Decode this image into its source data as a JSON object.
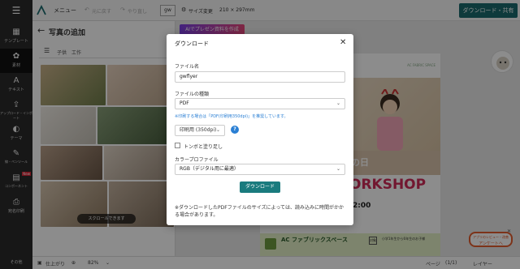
{
  "topbar": {
    "menu_label": "メニュー",
    "undo_label": "元に戻す",
    "redo_label": "やり直し",
    "gw_label": "gw",
    "size_change_label": "サイズ変更",
    "size_value": "210 × 297mm",
    "download_share_label": "ダウンロード・共有"
  },
  "sidebar": {
    "items": [
      {
        "label": "テンプレート",
        "icon": "template-icon"
      },
      {
        "label": "素材",
        "icon": "material-icon"
      },
      {
        "label": "テキスト",
        "icon": "text-icon"
      },
      {
        "label": "アップロード・インポート",
        "icon": "upload-icon"
      },
      {
        "label": "テーマ",
        "icon": "theme-icon"
      },
      {
        "label": "線・ペンツール",
        "icon": "pen-icon"
      },
      {
        "label": "コンポーネント",
        "icon": "component-icon",
        "badge": "New"
      },
      {
        "label": "宛名印刷",
        "icon": "print-icon"
      }
    ],
    "bottom_label": "その他"
  },
  "panel": {
    "title": "写真の追加",
    "search_value": "子供　工作",
    "scroll_hint": "スクロールできます"
  },
  "canvas": {
    "ai_button_label": "AIでプレゼン資料を作成"
  },
  "flyer": {
    "tag": "AC FABRIC SPACE",
    "hi_text": "の日",
    "workshop_text": "ORKSHOP",
    "time_text": "2:00",
    "org_name": "AC ファブリックスペース",
    "grade_box": "対象",
    "grade_text": "小学1年生から6年生のお子様"
  },
  "survey": {
    "line1": "アプリのレビュー・改善",
    "line2": "アンケートへ"
  },
  "bottombar": {
    "finish_label": "仕上がり",
    "zoom_value": "82%",
    "page_label": "ページ",
    "page_count": "(1/1)",
    "layer_label": "レイヤー"
  },
  "modal": {
    "title": "ダウンロード",
    "filename_label": "ファイル名",
    "filename_value": "gwflyer",
    "filetype_label": "ファイルの種類",
    "filetype_value": "PDF",
    "note": "※印刷する場合は「PDF(印刷用350dpi)」を推奨しています。",
    "resolution_value": "印刷用 (350dpi)",
    "help_label": "?",
    "crop_label": "トンボと塗り足し",
    "profile_label": "カラープロファイル",
    "profile_value": "RGB（デジタル用に最適）",
    "download_button": "ダウンロード",
    "footnote": "※ダウンロードしたPDFファイルのサイズによっては、読み込みに時間がかかる場合があります。"
  }
}
